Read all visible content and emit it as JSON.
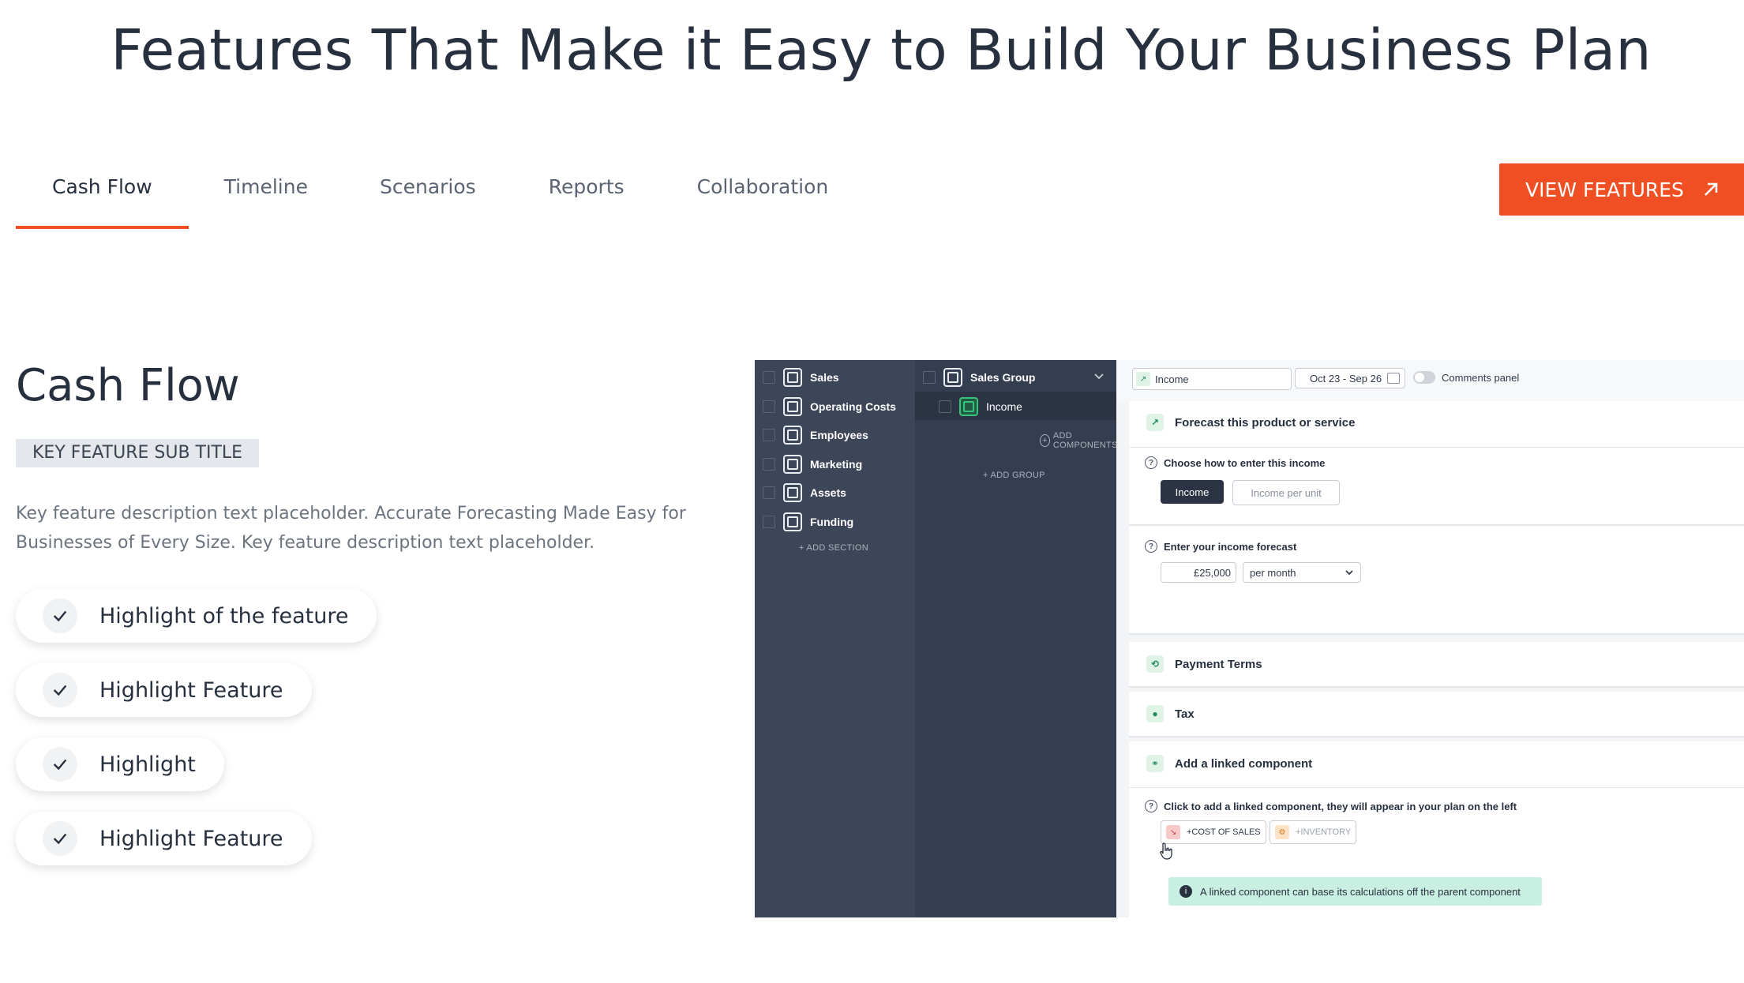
{
  "page": {
    "title": "Features That Make it Easy to Build Your Business Plan"
  },
  "tabs": [
    {
      "label": "Cash Flow",
      "active": true
    },
    {
      "label": "Timeline",
      "active": false
    },
    {
      "label": "Scenarios",
      "active": false
    },
    {
      "label": "Reports",
      "active": false
    },
    {
      "label": "Collaboration",
      "active": false
    }
  ],
  "cta": {
    "label": "VIEW FEATURES",
    "icon": "arrow-up-right-icon",
    "color": "#f04e23"
  },
  "feature": {
    "heading": "Cash Flow",
    "subtitle": "KEY FEATURE SUB TITLE",
    "description": "Key feature description text placeholder. Accurate Forecasting Made Easy for Businesses of Every Size. Key feature description text placeholder.",
    "highlights": [
      "Highlight of the feature",
      "Highlight Feature",
      "Highlight",
      "Highlight Feature"
    ]
  },
  "app": {
    "sections": [
      "Sales",
      "Operating Costs",
      "Employees",
      "Marketing",
      "Assets",
      "Funding"
    ],
    "add_section": "+ ADD SECTION",
    "group": {
      "name": "Sales Group",
      "item": "Income",
      "add_components": "ADD COMPONENTS",
      "add_group": "+ ADD GROUP"
    },
    "topbar": {
      "income_field": "Income",
      "date_range": "Oct 23 - Sep 26",
      "comments": "Comments panel"
    },
    "forecast": {
      "title": "Forecast this product or service",
      "choose_label": "Choose how to enter this income",
      "option_active": "Income",
      "option_inactive": "Income per unit",
      "enter_label": "Enter your income forecast",
      "amount": "£25,000",
      "period": "per month"
    },
    "payment_terms": "Payment Terms",
    "tax": "Tax",
    "linked": {
      "title": "Add a linked component",
      "hint": "Click to add a linked component, they will appear in your plan on the left",
      "chip1": "+COST OF SALES",
      "chip2": "+INVENTORY",
      "info": "A linked component can base its calculations off the parent component"
    }
  }
}
